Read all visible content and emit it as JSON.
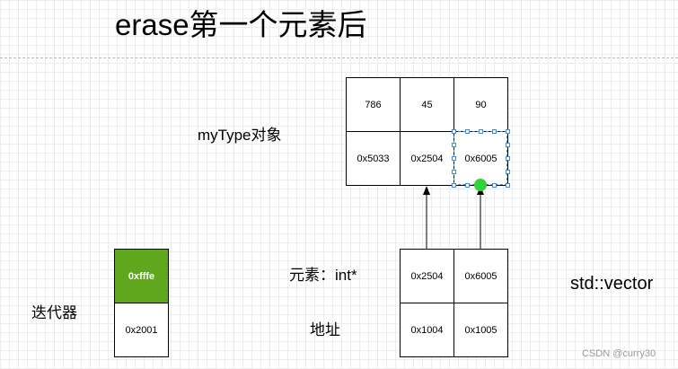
{
  "title": "erase第一个元素后",
  "labels": {
    "mytype_object": "myType对象",
    "iterator": "迭代器",
    "element_int_ptr": "元素：int*",
    "address": "地址",
    "std_vector": "std::vector"
  },
  "mytype_table": {
    "values": [
      "786",
      "45",
      "90"
    ],
    "addresses": [
      "0x5033",
      "0x2504",
      "0x6005"
    ]
  },
  "vector_table": {
    "elements": [
      "0x2504",
      "0x6005"
    ],
    "addresses": [
      "0x1004",
      "0x1005"
    ]
  },
  "iterator_table": {
    "value": "0xfffe",
    "address": "0x2001"
  },
  "watermark": "CSDN @curry30",
  "colors": {
    "iterator_highlight": "#5fa81e",
    "selection": "#2f8ee5",
    "connection_point": "#32d23c"
  }
}
